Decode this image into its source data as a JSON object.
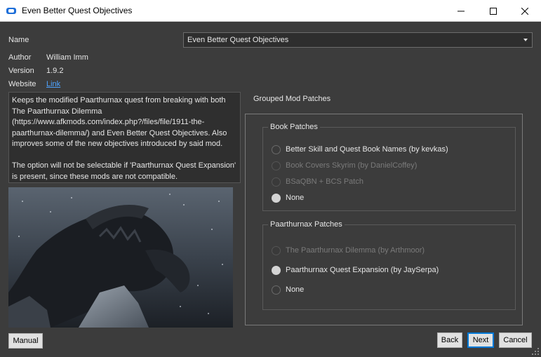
{
  "window": {
    "title": "Even Better Quest Objectives",
    "controls": [
      "minimize-icon",
      "maximize-icon",
      "close-icon"
    ]
  },
  "info": {
    "name_label": "Name",
    "author_label": "Author",
    "author_value": "William Imm",
    "version_label": "Version",
    "version_value": "1.9.2",
    "website_label": "Website",
    "website_link": "Link"
  },
  "name_select": {
    "value": "Even Better Quest Objectives"
  },
  "description": "Keeps the modified Paarthurnax quest from breaking with both The Paarthurnax Dilemma (https://www.afkmods.com/index.php?/files/file/1911-the-paarthurnax-dilemma/) and Even Better Quest Objectives. Also improves some of the new objectives introduced by said mod.\n\nThe option will not be selectable if 'Paarthurnax Quest Expansion' is present, since these mods are not compatible.",
  "group": {
    "title": "Grouped Mod Patches",
    "book": {
      "title": "Book Patches",
      "options": [
        {
          "label": "Better Skill and Quest Book Names (by kevkas)",
          "enabled": true,
          "checked": false
        },
        {
          "label": "Book Covers Skyrim (by DanielCoffey)",
          "enabled": false,
          "checked": false
        },
        {
          "label": "BSaQBN + BCS Patch",
          "enabled": false,
          "checked": false
        },
        {
          "label": "None",
          "enabled": true,
          "checked": true
        }
      ]
    },
    "paarthurnax": {
      "title": "Paarthurnax Patches",
      "options": [
        {
          "label": "The Paarthurnax Dilemma (by Arthmoor)",
          "enabled": false,
          "checked": false
        },
        {
          "label": "Paarthurnax Quest Expansion (by JaySerpa)",
          "enabled": true,
          "checked": true
        },
        {
          "label": "None",
          "enabled": true,
          "checked": false
        }
      ]
    }
  },
  "buttons": {
    "manual": "Manual",
    "back": "Back",
    "next": "Next",
    "cancel": "Cancel"
  },
  "colors": {
    "background": "#3c3c3c",
    "link": "#4ea3ff",
    "accent": "#0078d7"
  }
}
